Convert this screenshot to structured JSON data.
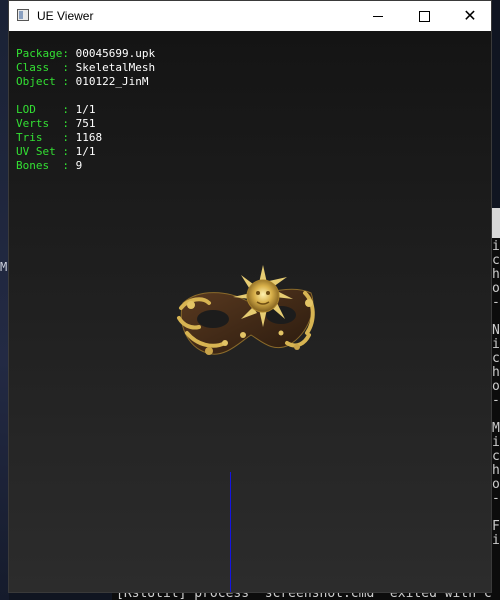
{
  "window": {
    "title": "UE Viewer",
    "controls": {
      "minimize": "minimize",
      "maximize": "maximize",
      "close": "close"
    }
  },
  "info": {
    "package": {
      "key": "Package:",
      "value": "00045699.upk"
    },
    "class": {
      "key": "Class  :",
      "value": "SkeletalMesh"
    },
    "object": {
      "key": "Object :",
      "value": "010122_JinM"
    },
    "lod": {
      "key": "LOD    :",
      "value": "1/1"
    },
    "verts": {
      "key": "Verts  :",
      "value": "751"
    },
    "tris": {
      "key": "Tris   :",
      "value": "1168"
    },
    "uvset": {
      "key": "UV Set :",
      "value": "1/1"
    },
    "bones": {
      "key": "Bones  :",
      "value": "9"
    }
  },
  "background": {
    "left_char": "M",
    "console_lines": "i\nc\nh\no\n-\n\nN\ni\nc\nh\no\n-\n\nM\ni\nc\nh\no\n-\n\nF\ni",
    "bottom_text": "[RstUtil] process \"screenshot.cmd\" exited with c"
  },
  "colors": {
    "label": "#33e033",
    "value": "#ffffff",
    "axis": "#1515e0"
  },
  "icons": [
    "app-icon",
    "minimize-icon",
    "maximize-icon",
    "close-icon"
  ]
}
